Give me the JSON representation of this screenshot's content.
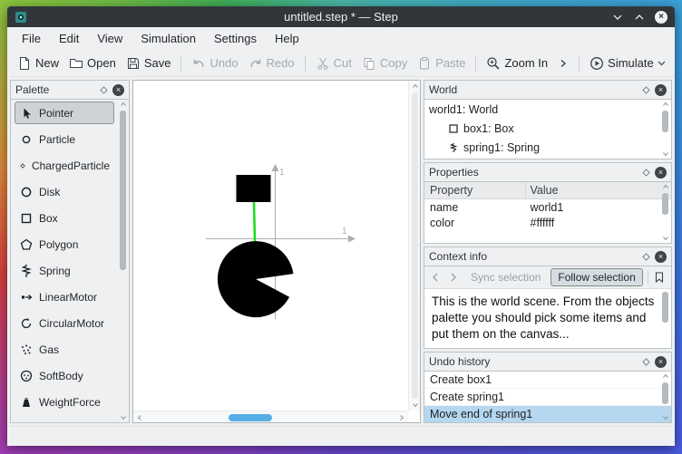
{
  "colors": {
    "accent": "#3daee9",
    "titlebar_bg": "#31363b",
    "spring": "#17dd17",
    "object": "#000000",
    "selection_bg": "#b5d7ef"
  },
  "window": {
    "title": "untitled.step * — Step"
  },
  "menubar": {
    "items": [
      "File",
      "Edit",
      "View",
      "Simulation",
      "Settings",
      "Help"
    ]
  },
  "toolbar": {
    "new": "New",
    "open": "Open",
    "save": "Save",
    "undo": "Undo",
    "redo": "Redo",
    "cut": "Cut",
    "copy": "Copy",
    "paste": "Paste",
    "zoom_in": "Zoom In",
    "simulate": "Simulate"
  },
  "palette": {
    "title": "Palette",
    "items": [
      {
        "label": "Pointer",
        "selected": true
      },
      {
        "label": "Particle"
      },
      {
        "label": "ChargedParticle"
      },
      {
        "label": "Disk"
      },
      {
        "label": "Box"
      },
      {
        "label": "Polygon"
      },
      {
        "label": "Spring"
      },
      {
        "label": "LinearMotor"
      },
      {
        "label": "CircularMotor"
      },
      {
        "label": "Gas"
      },
      {
        "label": "SoftBody"
      },
      {
        "label": "WeightForce"
      }
    ]
  },
  "canvas": {
    "x_axis_label": "1",
    "y_axis_label": "1"
  },
  "world_panel": {
    "title": "World",
    "root": "world1: World",
    "children": [
      {
        "label": "box1: Box"
      },
      {
        "label": "spring1: Spring"
      }
    ]
  },
  "properties_panel": {
    "title": "Properties",
    "columns": {
      "property": "Property",
      "value": "Value"
    },
    "rows": [
      {
        "property": "name",
        "value": "world1"
      },
      {
        "property": "color",
        "value": "#ffffff"
      }
    ]
  },
  "context_panel": {
    "title": "Context info",
    "sync_label": "Sync selection",
    "follow_label": "Follow selection",
    "text": "This is the world scene. From the objects palette you should pick some items and put them on the canvas..."
  },
  "undo_panel": {
    "title": "Undo history",
    "items": [
      {
        "label": "Create box1"
      },
      {
        "label": "Create spring1"
      },
      {
        "label": "Move end of spring1",
        "selected": true
      }
    ]
  }
}
